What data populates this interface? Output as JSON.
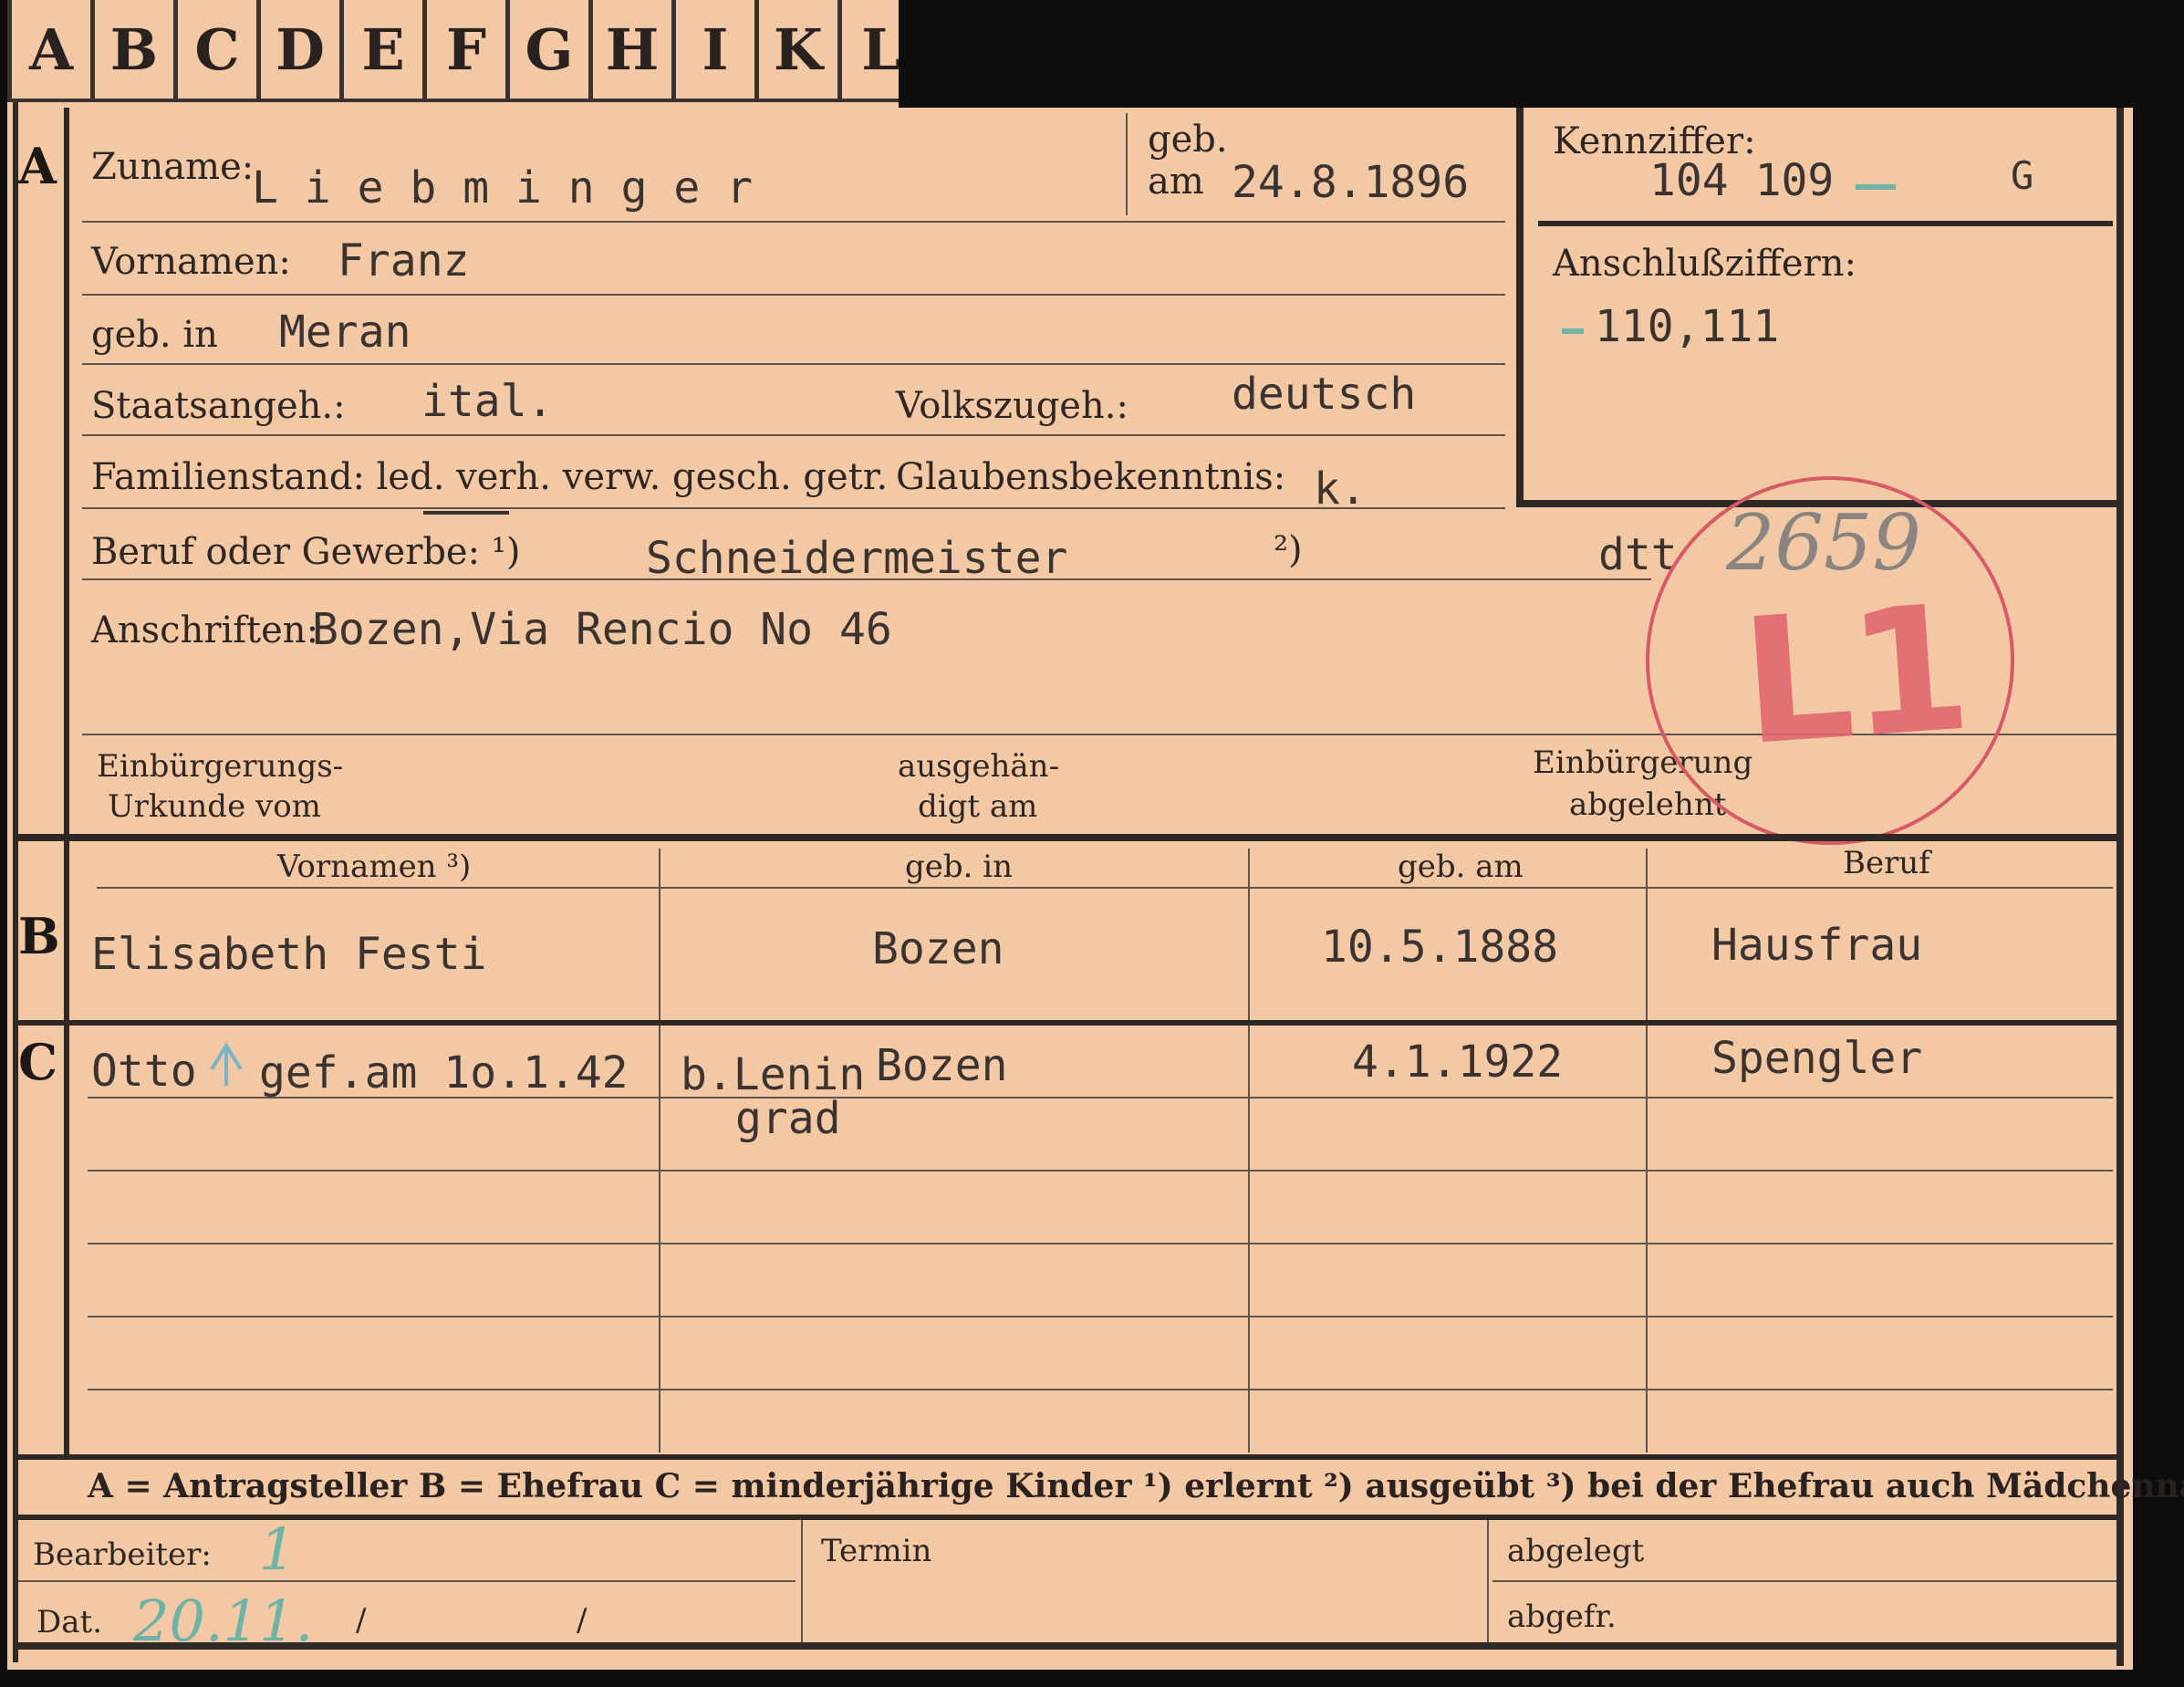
{
  "tabs": [
    "A",
    "B",
    "C",
    "D",
    "E",
    "F",
    "G",
    "H",
    "I",
    "K",
    "L"
  ],
  "section_a": {
    "marker": "A",
    "zuname_label": "Zuname:",
    "zuname_value": "L i e b m i n g e r",
    "geb_label": "geb.",
    "am_label": "am",
    "geb_am_value": "24.8.1896",
    "vornamen_label": "Vornamen:",
    "vornamen_value": "Franz",
    "geb_in_label": "geb. in",
    "geb_in_value": "Meran",
    "staatsangeh_label": "Staatsangeh.:",
    "staatsangeh_value": "ital.",
    "volkszugeh_label": "Volkszugeh.:",
    "volkszugeh_value": "deutsch",
    "familienstand_label": "Familienstand: led. verh. verw. gesch. getr.",
    "glaubensbekenntnis_label": "Glaubensbekenntnis:",
    "glaubensbekenntnis_value": "k.",
    "beruf_label": "Beruf oder Gewerbe: ¹)",
    "beruf_value": "Schneidermeister",
    "beruf_note2": "²)",
    "dtt_value": "dtt",
    "anschriften_label": "Anschriften:",
    "anschriften_value": "Bozen,Via Rencio No 46",
    "einbuergerung_label_1": "Einbürgerungs-",
    "einbuergerung_label_2": "Urkunde vom",
    "ausgehaendigt_label_1": "ausgehän-",
    "ausgehaendigt_label_2": "digt am",
    "abgelehnt_label_1": "Einbürgerung",
    "abgelehnt_label_2": "abgelehnt"
  },
  "kennziffer": {
    "label": "Kennziffer:",
    "value": "104 109",
    "suffix": "G",
    "anschluss_label": "Anschlußziffern:",
    "anschluss_value": "110,111"
  },
  "stamp": {
    "text": "L1",
    "pencil_number": "2659"
  },
  "section_b": {
    "marker": "B",
    "headers": [
      "Vornamen ³)",
      "geb. in",
      "geb. am",
      "Beruf"
    ],
    "row": [
      "Elisabeth Festi",
      "Bozen",
      "10.5.1888",
      "Hausfrau"
    ]
  },
  "section_c": {
    "marker": "C",
    "row": {
      "name": "Otto",
      "remark": "gef.am 1o.1.42",
      "place_prefix": "b.Lenin",
      "place_prefix_2": "grad",
      "place": "Bozen",
      "date": "4.1.1922",
      "beruf": "Spengler"
    }
  },
  "legend": "A = Antragsteller   B = Ehefrau   C = minderjährige Kinder   ¹) erlernt   ²) ausgeübt   ³) bei der Ehefrau auch Mädchenname",
  "footer": {
    "bearbeiter_label": "Bearbeiter:",
    "bearbeiter_value": "1",
    "dat_label": "Dat.",
    "dat_value": "20.11.",
    "slash1": "/",
    "slash2": "/",
    "termin_label": "Termin",
    "abgelegt_label": "abgelegt",
    "abgefr_label": "abgefr."
  },
  "colors": {
    "paper": "#f3c8a4",
    "ink": "#2a2220",
    "stamp_red": "#d75a66",
    "blue_pencil": "#6fb3a6"
  }
}
